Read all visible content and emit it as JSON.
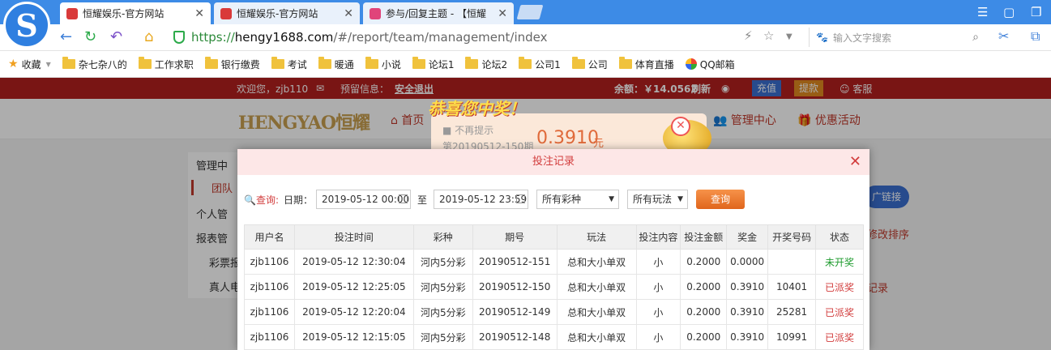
{
  "browser": {
    "tabs": [
      {
        "title": "恒耀娱乐-官方网站",
        "active": true
      },
      {
        "title": "恒耀娱乐-官方网站",
        "active": false
      },
      {
        "title": "参与/回复主题 - 【恒耀",
        "active": false
      }
    ],
    "url": {
      "scheme": "https://",
      "host": "hengy1688.com",
      "path": "/#/report/team/management/index"
    },
    "search_placeholder": "输入文字搜索",
    "bookmarks": [
      "收藏",
      "杂七杂八的",
      "工作求职",
      "银行缴费",
      "考试",
      "暖通",
      "小说",
      "论坛1",
      "论坛2",
      "公司1",
      "公司",
      "体育直播",
      "QQ邮箱"
    ]
  },
  "site": {
    "welcome": "欢迎您，zjb110",
    "notice": "预留信息：",
    "logout": "安全退出",
    "balance": "余额：￥14.0562",
    "refresh": "刷新",
    "deposit": "充值",
    "withdraw": "提款",
    "service": "客服",
    "logo": "HENGYAO恒耀",
    "nav_home": "首页",
    "nav_manage": "管理中心",
    "nav_promo": "优惠活动",
    "sidebar": [
      "管理中",
      "团队",
      "个人管",
      "报表管",
      "彩票报",
      "真人电"
    ],
    "right_link": "广链接",
    "right_sort": "修改排序",
    "right_record": "记录"
  },
  "prize_popup": {
    "banner": "恭喜您中奖！",
    "no_remind": "不再提示",
    "issue": "第20190512-150期",
    "amount": "0.3910",
    "unit": "元"
  },
  "modal": {
    "title": "投注记录",
    "query_label": "查询:",
    "date_label": "日期：",
    "date_from": "2019-05-12 00:00",
    "to_label": "至",
    "date_to": "2019-05-12 23:59",
    "lottery_select": "所有彩种",
    "play_select": "所有玩法",
    "query_button": "查询",
    "columns": [
      "用户名",
      "投注时间",
      "彩种",
      "期号",
      "玩法",
      "投注内容",
      "投注金额",
      "奖金",
      "开奖号码",
      "状态"
    ],
    "rows": [
      [
        "zjb1106",
        "2019-05-12 12:30:04",
        "河内5分彩",
        "20190512-151",
        "总和大小单双",
        "小",
        "0.2000",
        "0.0000",
        "",
        "未开奖"
      ],
      [
        "zjb1106",
        "2019-05-12 12:25:05",
        "河内5分彩",
        "20190512-150",
        "总和大小单双",
        "小",
        "0.2000",
        "0.3910",
        "10401",
        "已派奖"
      ],
      [
        "zjb1106",
        "2019-05-12 12:20:04",
        "河内5分彩",
        "20190512-149",
        "总和大小单双",
        "小",
        "0.2000",
        "0.3910",
        "25281",
        "已派奖"
      ],
      [
        "zjb1106",
        "2019-05-12 12:15:05",
        "河内5分彩",
        "20190512-148",
        "总和大小单双",
        "小",
        "0.2000",
        "0.3910",
        "10991",
        "已派奖"
      ]
    ]
  }
}
